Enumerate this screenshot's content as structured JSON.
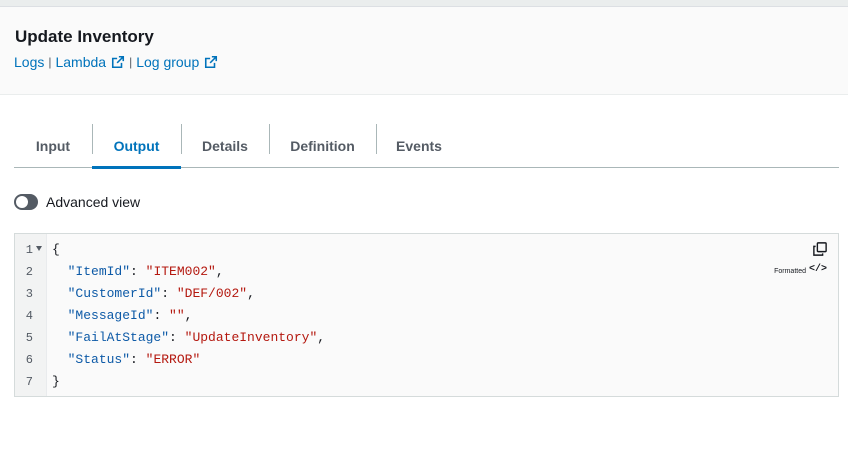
{
  "header": {
    "title": "Update Inventory",
    "links": {
      "logs": "Logs",
      "separator": "|",
      "lambda": "Lambda",
      "log_group": "Log group"
    }
  },
  "tabs": [
    {
      "label": "Input",
      "active": false
    },
    {
      "label": "Output",
      "active": true
    },
    {
      "label": "Details",
      "active": false
    },
    {
      "label": "Definition",
      "active": false
    },
    {
      "label": "Events",
      "active": false
    }
  ],
  "advanced_view": {
    "label": "Advanced view",
    "enabled": false
  },
  "editor": {
    "formatted_label": "Formatted",
    "format_icon": "</>",
    "line_numbers": [
      "1",
      "2",
      "3",
      "4",
      "5",
      "6",
      "7"
    ],
    "open_brace": "{",
    "close_brace": "}",
    "entries": [
      {
        "key": "\"ItemId\"",
        "value": "\"ITEM002\"",
        "trail": ","
      },
      {
        "key": "\"CustomerId\"",
        "value": "\"DEF/002\"",
        "trail": ","
      },
      {
        "key": "\"MessageId\"",
        "value": "\"\"",
        "trail": ","
      },
      {
        "key": "\"FailAtStage\"",
        "value": "\"UpdateInventory\"",
        "trail": ","
      },
      {
        "key": "\"Status\"",
        "value": "\"ERROR\"",
        "trail": ""
      }
    ]
  },
  "colors": {
    "link": "#0073bb",
    "tab_active": "#0073bb",
    "json_key": "#0d5aa7",
    "json_string": "#b4180f"
  },
  "icons": {
    "external_link": "external-link-icon",
    "copy": "copy-icon",
    "code": "code-icon",
    "fold": "fold-arrow-icon"
  }
}
